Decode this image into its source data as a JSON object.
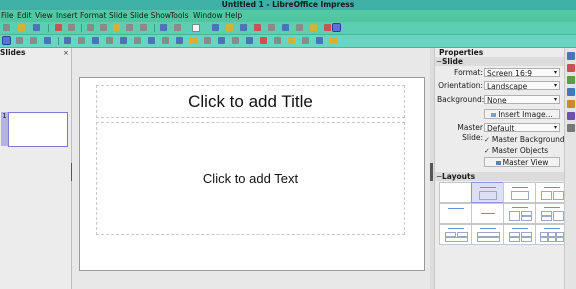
{
  "window": {
    "title": "Untitled 1 - LibreOffice Impress"
  },
  "menu": [
    "File",
    "Edit",
    "View",
    "Insert",
    "Format",
    "Slide",
    "Slide Show",
    "Tools",
    "Window",
    "Help"
  ],
  "slides_pane": {
    "title": "Slides",
    "close_glyph": "×",
    "slide_number": "1"
  },
  "slide": {
    "title_placeholder": "Click to add Title",
    "body_placeholder": "Click to add Text"
  },
  "properties": {
    "title": "Properties",
    "slide_section": {
      "title": "Slide",
      "format_label": "Format:",
      "format_value": "Screen 16:9",
      "orientation_label": "Orientation:",
      "orientation_value": "Landscape",
      "background_label": "Background:",
      "background_value": "None",
      "insert_image_button": "Insert Image...",
      "master_slide_label": "Master Slide:",
      "master_slide_value": "Default",
      "master_background_label": "Master Background",
      "master_objects_label": "Master Objects",
      "master_view_button": "Master View"
    },
    "layouts_section": {
      "title": "Layouts"
    }
  },
  "colors": {
    "title_bar": "#3fb0a5",
    "menu_bar": "#55c9a3",
    "toolbar": "#5ccfb0",
    "selection": "#7d7bd0"
  }
}
